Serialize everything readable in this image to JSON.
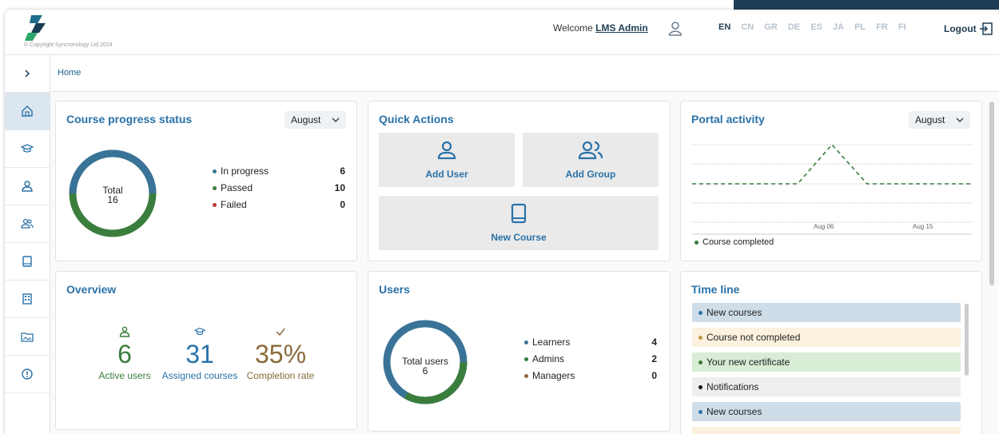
{
  "header": {
    "copyright": "© Copyright Syncronology Ltd 2024",
    "welcome_prefix": "Welcome",
    "user_name": "LMS Admin",
    "languages": [
      "EN",
      "CN",
      "GR",
      "DE",
      "ES",
      "JA",
      "PL",
      "FR",
      "FI"
    ],
    "active_language": "EN",
    "logout_label": "Logout"
  },
  "sidebar": {
    "expand_icon": "chevron-right-icon",
    "items": [
      {
        "icon": "home-icon",
        "active": true
      },
      {
        "icon": "graduation-cap-icon"
      },
      {
        "icon": "user-icon"
      },
      {
        "icon": "users-icon"
      },
      {
        "icon": "book-icon"
      },
      {
        "icon": "building-icon"
      },
      {
        "icon": "image-folder-icon"
      },
      {
        "icon": "info-icon"
      }
    ]
  },
  "breadcrumb": {
    "home": "Home"
  },
  "course_progress": {
    "title": "Course progress status",
    "month": "August",
    "total_label": "Total",
    "total": "16",
    "rows": [
      {
        "label": "In progress",
        "value": "6",
        "color": "#3a7398"
      },
      {
        "label": "Passed",
        "value": "10",
        "color": "#3a7d3d"
      },
      {
        "label": "Failed",
        "value": "0",
        "color": "#c0392b"
      }
    ]
  },
  "quick_actions": {
    "title": "Quick Actions",
    "add_user": "Add User",
    "add_group": "Add Group",
    "new_course": "New Course"
  },
  "portal_activity": {
    "title": "Portal activity",
    "month": "August",
    "legend": "Course completed"
  },
  "chart_data": {
    "type": "line",
    "x_ticks": [
      "Aug 06",
      "Aug 15"
    ],
    "series": [
      {
        "name": "Course completed",
        "color": "#3a7d3d"
      }
    ]
  },
  "overview": {
    "title": "Overview",
    "active_users": "6",
    "active_users_label": "Active users",
    "assigned_courses": "31",
    "assigned_courses_label": "Assigned courses",
    "completion_rate": "35%",
    "completion_rate_label": "Completion rate"
  },
  "users": {
    "title": "Users",
    "total_label": "Total users",
    "total": "6",
    "rows": [
      {
        "label": "Learners",
        "value": "4",
        "color": "#3a7398"
      },
      {
        "label": "Admins",
        "value": "2",
        "color": "#3a7d3d"
      },
      {
        "label": "Managers",
        "value": "0",
        "color": "#8a6a3a"
      }
    ]
  },
  "timeline": {
    "title": "Time line",
    "items": [
      {
        "label": "New courses",
        "bg": "#cfdde9",
        "dot": "#2a72a8"
      },
      {
        "label": "Course not completed",
        "bg": "#fbf1de",
        "dot": "#c19a4f"
      },
      {
        "label": "Your new certificate",
        "bg": "#d8ecd6",
        "dot": "#3a7d3d"
      },
      {
        "label": "Notifications",
        "bg": "#eeeeee",
        "dot": "#111111"
      },
      {
        "label": "New courses",
        "bg": "#cfdde9",
        "dot": "#2a72a8"
      }
    ]
  }
}
